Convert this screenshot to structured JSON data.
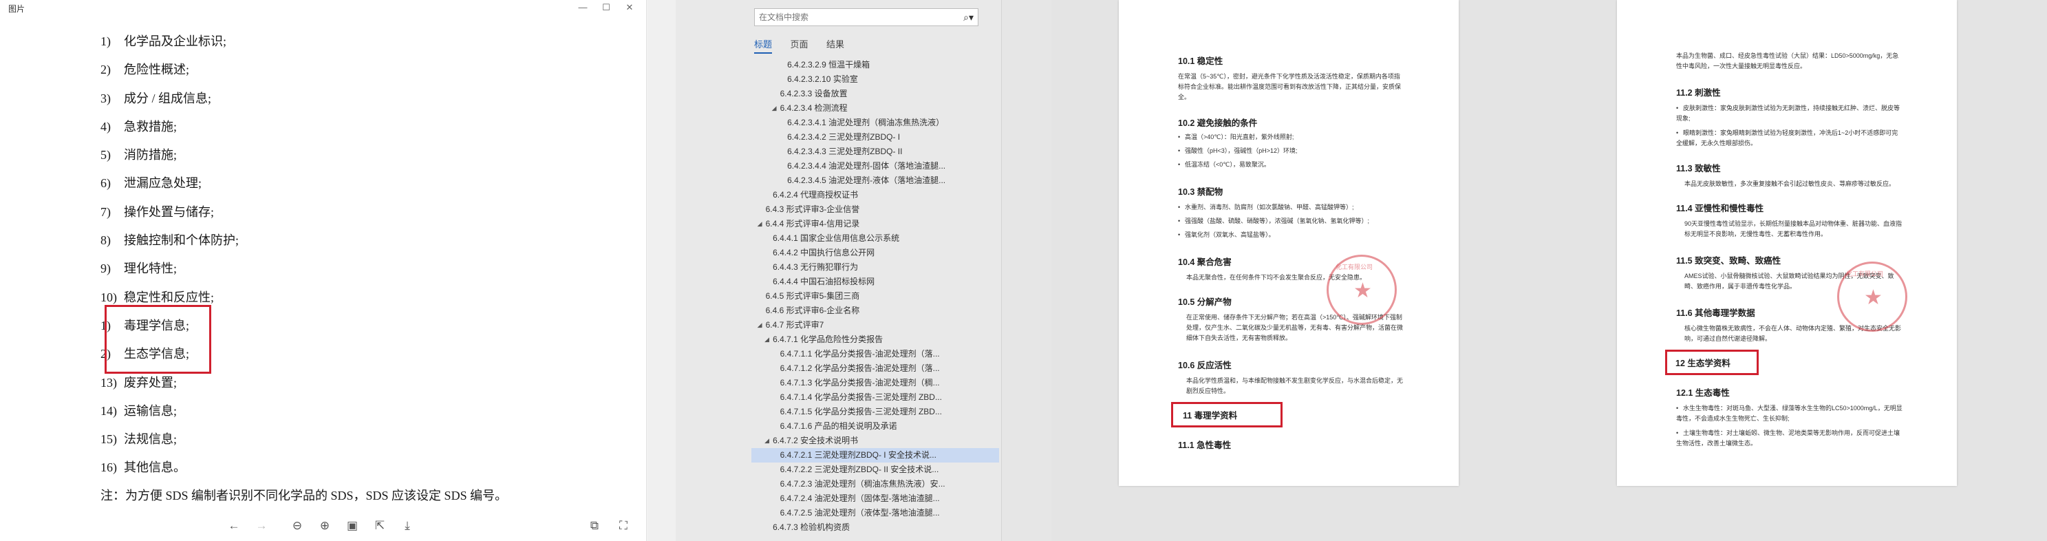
{
  "viewer": {
    "title": "图片",
    "controls": {
      "minimize": "—",
      "maximize": "☐",
      "close": "✕"
    },
    "lines": [
      {
        "num": "1)",
        "text": "化学品及企业标识;"
      },
      {
        "num": "2)",
        "text": "危险性概述;"
      },
      {
        "num": "3)",
        "text": "成分 / 组成信息;"
      },
      {
        "num": "4)",
        "text": "急救措施;"
      },
      {
        "num": "5)",
        "text": "消防措施;"
      },
      {
        "num": "6)",
        "text": "泄漏应急处理;"
      },
      {
        "num": "7)",
        "text": "操作处置与储存;"
      },
      {
        "num": "8)",
        "text": "接触控制和个体防护;"
      },
      {
        "num": "9)",
        "text": "理化特性;"
      },
      {
        "num": "10)",
        "text": "稳定性和反应性;"
      },
      {
        "num": "1)",
        "text": "毒理学信息;"
      },
      {
        "num": "2)",
        "text": "生态学信息;"
      },
      {
        "num": "13)",
        "text": "废弃处置;"
      },
      {
        "num": "14)",
        "text": "运输信息;"
      },
      {
        "num": "15)",
        "text": "法规信息;"
      },
      {
        "num": "16)",
        "text": "其他信息。"
      }
    ],
    "note": "注：为方便 SDS 编制者识别不同化学品的 SDS，SDS 应该设定 SDS 编号。"
  },
  "nav": {
    "search_placeholder": "在文档中搜索",
    "tabs": [
      "标题",
      "页面",
      "结果"
    ],
    "items": [
      {
        "text": "6.4.2.3.2.9 恒温干燥箱",
        "level": 4
      },
      {
        "text": "6.4.2.3.2.10 实验室",
        "level": 4
      },
      {
        "text": "6.4.2.3.3 设备放置",
        "level": 3
      },
      {
        "text": "6.4.2.3.4 检测流程",
        "level": 3,
        "arrow": "◢"
      },
      {
        "text": "6.4.2.3.4.1 油泥处理剂（稠油冻焦热洗液）",
        "level": 4
      },
      {
        "text": "6.4.2.3.4.2 三泥处理剂ZBDQ- I",
        "level": 4
      },
      {
        "text": "6.4.2.3.4.3 三泥处理剂ZBDQ- II",
        "level": 4
      },
      {
        "text": "6.4.2.3.4.4 油泥处理剂-固体（落地油渣腿...",
        "level": 4
      },
      {
        "text": "6.4.2.3.4.5 油泥处理剂-液体（落地油渣腿...",
        "level": 4
      },
      {
        "text": "6.4.2.4 代理商授权证书",
        "level": 2
      },
      {
        "text": "6.4.3 形式评审3-企业信誉",
        "level": 1
      },
      {
        "text": "6.4.4 形式评审4-信用记录",
        "level": 1,
        "arrow": "◢"
      },
      {
        "text": "6.4.4.1 国家企业信用信息公示系统",
        "level": 2
      },
      {
        "text": "6.4.4.2 中国执行信息公开网",
        "level": 2
      },
      {
        "text": "6.4.4.3 无行贿犯罪行为",
        "level": 2
      },
      {
        "text": "6.4.4.4 中国石油招标投标网",
        "level": 2
      },
      {
        "text": "6.4.5 形式评审5-集团三商",
        "level": 1
      },
      {
        "text": "6.4.6 形式评审6-企业名称",
        "level": 1
      },
      {
        "text": "6.4.7 形式评审7",
        "level": 1,
        "arrow": "◢"
      },
      {
        "text": "6.4.7.1 化学品危险性分类报告",
        "level": 2,
        "arrow": "◢"
      },
      {
        "text": "6.4.7.1.1 化学品分类报告-油泥处理剂（落...",
        "level": 3
      },
      {
        "text": "6.4.7.1.2 化学品分类报告-油泥处理剂（落...",
        "level": 3
      },
      {
        "text": "6.4.7.1.3 化学品分类报告-油泥处理剂（稠...",
        "level": 3
      },
      {
        "text": "6.4.7.1.4 化学品分类报告-三泥处理剂 ZBD...",
        "level": 3
      },
      {
        "text": "6.4.7.1.5 化学品分类报告-三泥处理剂 ZBD...",
        "level": 3
      },
      {
        "text": "6.4.7.1.6 产品的相关说明及承诺",
        "level": 3
      },
      {
        "text": "6.4.7.2 安全技术说明书",
        "level": 2,
        "arrow": "◢"
      },
      {
        "text": "6.4.7.2.1 三泥处理剂ZBDQ- I 安全技术说...",
        "level": 3,
        "selected": true
      },
      {
        "text": "6.4.7.2.2 三泥处理剂ZBDQ- II 安全技术说...",
        "level": 3
      },
      {
        "text": "6.4.7.2.3 油泥处理剂（稠油冻焦热洗液）安...",
        "level": 3
      },
      {
        "text": "6.4.7.2.4 油泥处理剂（固体型-落地油渣腿...",
        "level": 3
      },
      {
        "text": "6.4.7.2.5 油泥处理剂（液体型-落地油渣腿...",
        "level": 3
      },
      {
        "text": "6.4.7.3 检验机构资质",
        "level": 2
      }
    ]
  },
  "page1": {
    "s101_title": "10.1 稳定性",
    "s101_body": "在常温（5~35℃），密封，避光条件下化学性质及活泼活性稳定，保质期内各项指标符合企业标准。能出耕作温度范围可看到有改放活性下降，正其结分量，安质保全。",
    "s102_title": "10.2 避免接触的条件",
    "s102_b1": "高温（>40℃）：阳光直射，紫外线照射;",
    "s102_b2": "强酸性（pH<3），强碱性（pH>12）环境;",
    "s102_b3": "低温冻结（<0℃），易致聚沉。",
    "s103_title": "10.3 禁配物",
    "s103_b1": "水重剂、消毒剂、防腐剂（如次氯酸钠、甲醛、高锰酸钾等）;",
    "s103_b2": "强强酸（盐酸、硫酸、硝酸等），浓强碱（氢氧化钠、氢氧化钾等）;",
    "s103_b3": "强氧化剂（双氧水、高锰盐等）。",
    "s104_title": "10.4 聚合危害",
    "s104_body": "本品无聚合性，在任何条件下均不会发生聚合反应，无安全隐患。",
    "s105_title": "10.5 分解产物",
    "s105_body": "在正常使用、储存条件下无分解产物；若在高温（>150℃）、强碱解环境下强制处理，仅产生水、二氧化碳及少量无机盐等，无有毒、有害分解产物，活菌在微细体下自失去活性，无有害物质释放。",
    "s106_title": "10.6 反应活性",
    "s106_body": "本品化学性质温和，与本维配物接触不发生剧变化学反应，与水混合后稳定，无剧烈反应特性。",
    "s11_title": "11 毒理学资料",
    "s111_title": "11.1 急性毒性",
    "seal_text": "化工有限公司"
  },
  "page2": {
    "top_body": "本品为生物菌、成口、经皮急性毒性试验（大鼠）结果：LD50>5000mg/kg，无急性中毒风险，一次性大量接触无明显毒性反应。",
    "s112_title": "11.2 刺激性",
    "s112_b1": "皮肤刺激性：家兔皮肤刺激性试验为无刺激性，持续接触无红肿、溃烂、脱皮等现象;",
    "s112_b2": "眼睛刺激性：家兔眼睛刺激性试验为轻度刺激性，冲洗后1~2小时不适感即可完全缓解，无永久性眼部损伤。",
    "s113_title": "11.3 致敏性",
    "s113_body": "本品无皮肤致敏性，多次重复接触不会引起过敏性皮炎、荨麻疹等过敏反应。",
    "s114_title": "11.4 亚慢性和慢性毒性",
    "s114_body": "90天亚慢性毒性试验显示，长期低剂量接触本品对动物体重、脏器功能、血液指标无明显不良影响，无慢性毒性、无蓄积毒性作用。",
    "s115_title": "11.5 致突变、致畸、致癌性",
    "s115_body": "AMES试验、小鼠骨髓微核试验、大鼠致畸试验结果均为阴性，无致突变、致畸、致癌作用，属于非遗传毒性化学品。",
    "s116_title": "11.6 其他毒理学数据",
    "s116_body": "核心微生物菌株无致病性，不会在人体、动物体内定殖、繁殖，对生态安全无影响，可通过自然代谢途径降解。",
    "s12_title": "12 生态学资料",
    "s121_title": "12.1 生态毒性",
    "s121_b1": "水生生物毒性：对斑马鱼、大型溞、绿藻等水生生物的LC50>1000mg/L，无明显毒性，不会造成水生生物死亡、生长抑制;",
    "s121_b2": "土壤生物毒性：对土壤蚯蚓、微生物、泥地类菜等无影响作用，反而可促进土壤生物活性，改善土壤微生态。",
    "seal_text": "化工有限公司"
  },
  "colors": {
    "highlight_box": "#d0202e",
    "nav_selected": "#c9d9f2",
    "accent": "#1e5fb4"
  }
}
